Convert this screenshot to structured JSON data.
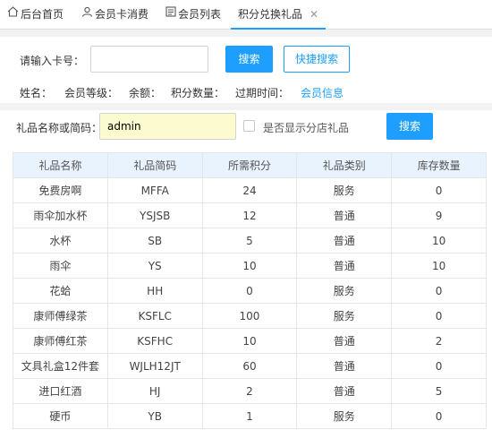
{
  "tabs": [
    {
      "label": "后台首页",
      "icon": "home-icon"
    },
    {
      "label": "会员卡消费",
      "icon": "user-icon"
    },
    {
      "label": "会员列表",
      "icon": "list-icon"
    },
    {
      "label": "积分兑换礼品",
      "icon": "",
      "active": true,
      "close": "✕"
    }
  ],
  "member_search": {
    "card_label": "请输入卡号：",
    "card_value": "",
    "search_button": "搜索",
    "quick_search_button": "快捷搜索",
    "name_label": "姓名：",
    "level_label": "会员等级：",
    "balance_label": "余额：",
    "points_label": "积分数量：",
    "expire_label": "过期时间：",
    "member_info_link": "会员信息"
  },
  "gift_search": {
    "label": "礼品名称或简码：",
    "value": "admin",
    "checkbox_label": "是否显示分店礼品",
    "checkbox_checked": false,
    "search_button": "搜索"
  },
  "table": {
    "headers": [
      "礼品名称",
      "礼品简码",
      "所需积分",
      "礼品类别",
      "库存数量"
    ],
    "rows": [
      [
        "免费房啊",
        "MFFA",
        "24",
        "服务",
        "0"
      ],
      [
        "雨伞加水杯",
        "YSJSB",
        "12",
        "普通",
        "9"
      ],
      [
        "水杯",
        "SB",
        "5",
        "普通",
        "10"
      ],
      [
        "雨伞",
        "YS",
        "10",
        "普通",
        "10"
      ],
      [
        "花蛤",
        "HH",
        "0",
        "服务",
        "0"
      ],
      [
        "康师傅绿茶",
        "KSFLC",
        "100",
        "服务",
        "0"
      ],
      [
        "康师傅红茶",
        "KSFHC",
        "10",
        "普通",
        "2"
      ],
      [
        "文具礼盒12件套",
        "WJLH12JT",
        "60",
        "普通",
        "0"
      ],
      [
        "进口红酒",
        "HJ",
        "2",
        "普通",
        "5"
      ],
      [
        "硬币",
        "YB",
        "1",
        "服务",
        "0"
      ]
    ]
  },
  "colors": {
    "accent": "#1e9fff",
    "input_highlight": "#fbfbcf",
    "table_header": "#e8f3fd",
    "background_gap": "#f2f2f2"
  }
}
